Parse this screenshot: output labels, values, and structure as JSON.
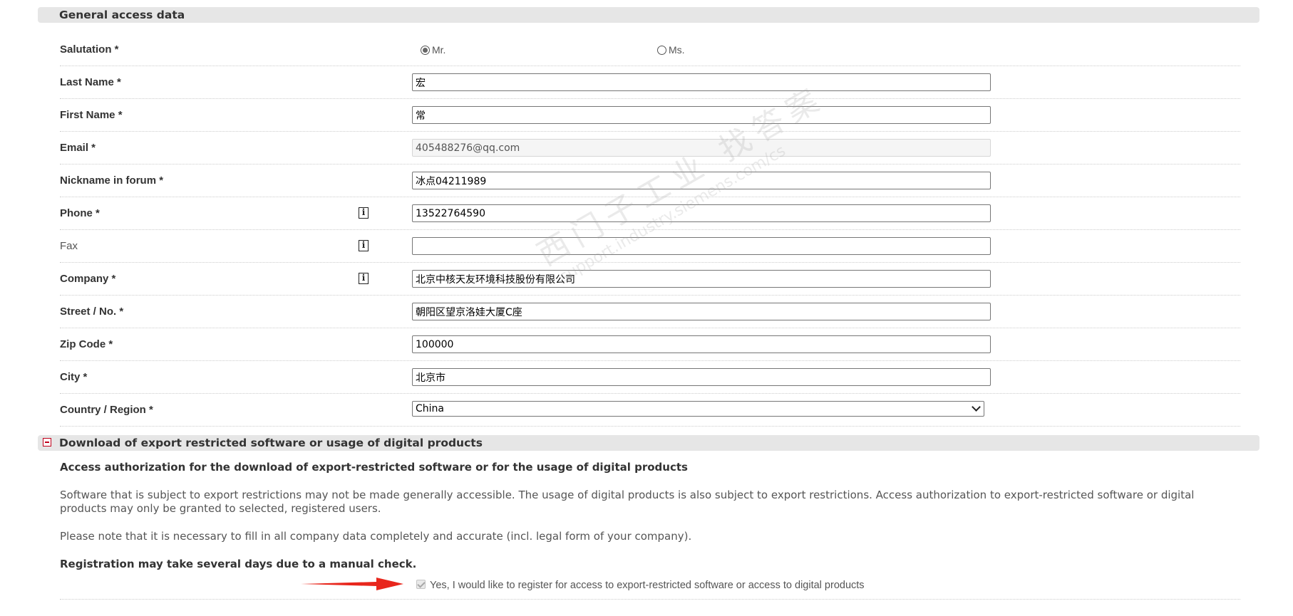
{
  "sections": {
    "general": {
      "title": "General access data"
    },
    "export": {
      "title": "Download of export restricted software or usage of digital products"
    }
  },
  "form": {
    "salutation": {
      "label": "Salutation *",
      "options": [
        {
          "label": "Mr.",
          "checked": true
        },
        {
          "label": "Ms.",
          "checked": false
        }
      ]
    },
    "last_name": {
      "label": "Last Name *",
      "value": "宏"
    },
    "first_name": {
      "label": "First Name *",
      "value": "常"
    },
    "email": {
      "label": "Email *",
      "value": "405488276@qq.com"
    },
    "nickname": {
      "label": "Nickname in forum *",
      "value": "冰点04211989"
    },
    "phone": {
      "label": "Phone *",
      "value": "13522764590"
    },
    "fax": {
      "label": "Fax",
      "value": ""
    },
    "company": {
      "label": "Company *",
      "value": "北京中核天友环境科技股份有限公司"
    },
    "street": {
      "label": "Street / No. *",
      "value": "朝阳区望京洛娃大厦C座"
    },
    "zip": {
      "label": "Zip Code *",
      "value": "100000"
    },
    "city": {
      "label": "City *",
      "value": "北京市"
    },
    "country": {
      "label": "Country / Region *",
      "value": "China"
    }
  },
  "info_icon_glyph": "i",
  "export_info": {
    "heading": "Access authorization for the download of export-restricted software or for the usage of digital products",
    "paragraph1": "Software that is subject to export restrictions may not be made generally accessible. The usage of digital products is also subject to export restrictions. Access authorization to export-restricted software or digital products may only be granted to selected, registered users.",
    "paragraph2": "Please note that it is necessary to fill in all company data completely and accurate (incl. legal form of your company).",
    "note": "Registration may take several days due to a manual check.",
    "consent_label": "Yes, I would like to register for access to export-restricted software or access to digital products",
    "consent_checked": true
  },
  "watermark": {
    "line1": "西门子工业 找答案",
    "line2": "support.industry.siemens.com/cs"
  },
  "colors": {
    "section_bg": "#e6e6e6",
    "toggle": "#c0001c",
    "arrow": "#e8261c"
  }
}
